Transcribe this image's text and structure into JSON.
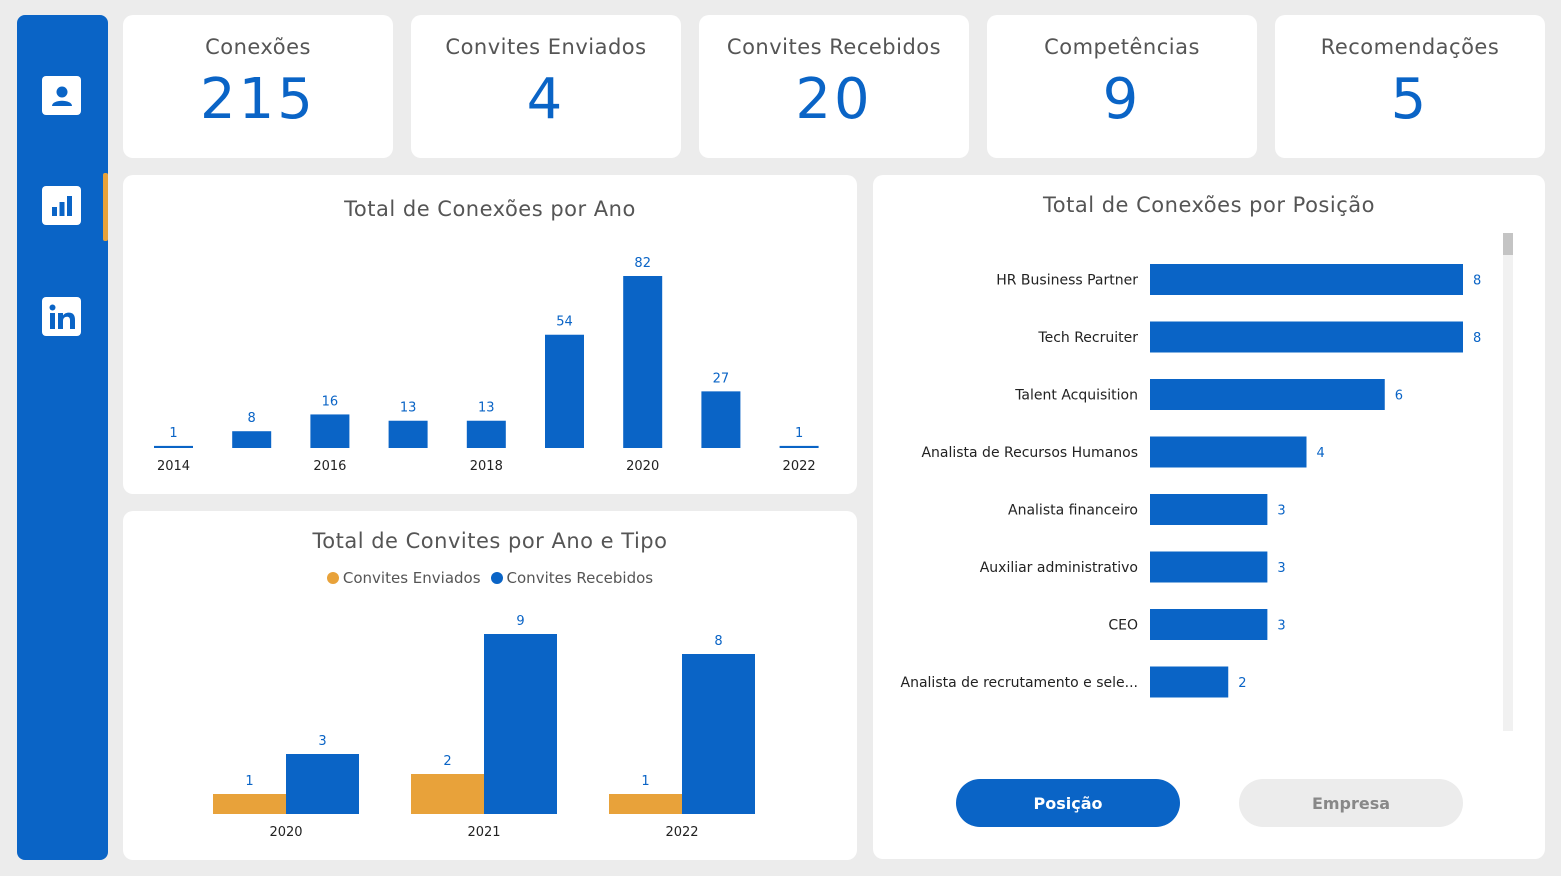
{
  "sidebar": {
    "items": [
      {
        "name": "profile",
        "icon": "user-icon"
      },
      {
        "name": "dashboard",
        "icon": "bar-chart-icon",
        "active": true
      },
      {
        "name": "linkedin",
        "icon": "linkedin-icon"
      }
    ]
  },
  "kpis": [
    {
      "label": "Conexões",
      "value": "215"
    },
    {
      "label": "Convites Enviados",
      "value": "4"
    },
    {
      "label": "Convites Recebidos",
      "value": "20"
    },
    {
      "label": "Competências",
      "value": "9"
    },
    {
      "label": "Recomendações",
      "value": "5"
    }
  ],
  "colors": {
    "primary": "#0a64c6",
    "accent": "#e8a23a"
  },
  "chart_data": [
    {
      "type": "bar",
      "title": "Total de Conexões por Ano",
      "categories": [
        "2014",
        "2015",
        "2016",
        "2017",
        "2018",
        "2019",
        "2020",
        "2021",
        "2022"
      ],
      "tick_labels": [
        "2014",
        "",
        "2016",
        "",
        "2018",
        "",
        "2020",
        "",
        "2022"
      ],
      "values": [
        1,
        8,
        16,
        13,
        13,
        54,
        82,
        27,
        1
      ],
      "xlabel": "",
      "ylabel": "",
      "ylim": [
        0,
        82
      ],
      "grid": false
    },
    {
      "type": "bar",
      "title": "Total de Convites por Ano e Tipo",
      "categories": [
        "2020",
        "2021",
        "2022"
      ],
      "series": [
        {
          "name": "Convites Enviados",
          "values": [
            1,
            2,
            1
          ],
          "color": "#e8a23a"
        },
        {
          "name": "Convites Recebidos",
          "values": [
            3,
            9,
            8
          ],
          "color": "#0a64c6"
        }
      ],
      "legend": "top-center",
      "ylim": [
        0,
        9
      ],
      "grid": false
    },
    {
      "type": "bar",
      "orientation": "horizontal",
      "title": "Total de Conexões por Posição",
      "categories": [
        "HR Business Partner",
        "Tech Recruiter",
        "Talent Acquisition",
        "Analista de Recursos Humanos",
        "Analista financeiro",
        "Auxiliar administrativo",
        "CEO",
        "Analista de recrutamento e sele..."
      ],
      "values": [
        8,
        8,
        6,
        4,
        3,
        3,
        3,
        2
      ],
      "xlim": [
        0,
        8
      ],
      "grid": false
    }
  ],
  "toggle": {
    "position_label": "Posição",
    "company_label": "Empresa"
  }
}
